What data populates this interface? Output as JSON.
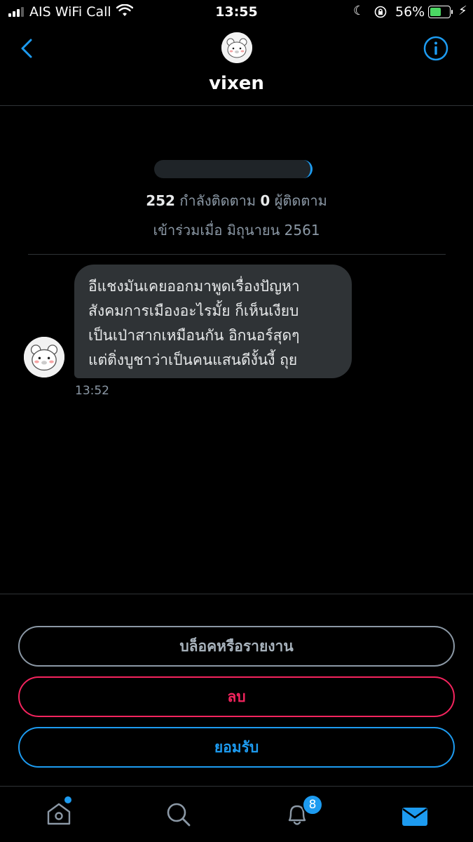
{
  "status_bar": {
    "carrier": "AIS WiFi Call",
    "time": "13:55",
    "battery_percent": "56%",
    "battery_level": 0.56,
    "icons": [
      "signal-icon",
      "wifi-icon",
      "moon-icon",
      "orientation-lock-icon",
      "battery-icon",
      "charging-bolt-icon"
    ]
  },
  "header": {
    "title": "vixen",
    "back_icon": "chevron-left-icon",
    "info_icon": "info-icon"
  },
  "profile": {
    "following_count": "252",
    "following_label": "กำลังติดตาม",
    "followers_count": "0",
    "followers_label": "ผู้ติดตาม",
    "joined": "เข้าร่วมเมื่อ มิถุนายน 2561"
  },
  "message": {
    "text": "อีแชงมันเคยออกมาพูดเรื่องปัญหา\nสังคมการเมืองอะไรมั้ย ก็เห็นเงียบ\nเป็นเป่าสากเหมือนกัน อิกนอร์สุดๆ\nแต่ติ่งบูชาว่าเป็นคนแสนดีงั้นงี้ ถุย",
    "time": "13:52"
  },
  "actions": {
    "block_report": "บล็อคหรือรายงาน",
    "delete": "ลบ",
    "accept": "ยอมรับ"
  },
  "tab_bar": {
    "notification_badge": "8",
    "icons": [
      "home-icon",
      "search-icon",
      "bell-icon",
      "mail-icon"
    ]
  },
  "colors": {
    "accent": "#1d9bf0",
    "danger": "#f4245e",
    "muted": "#8b98a5",
    "bubble": "#2f3336",
    "background": "#000000"
  }
}
